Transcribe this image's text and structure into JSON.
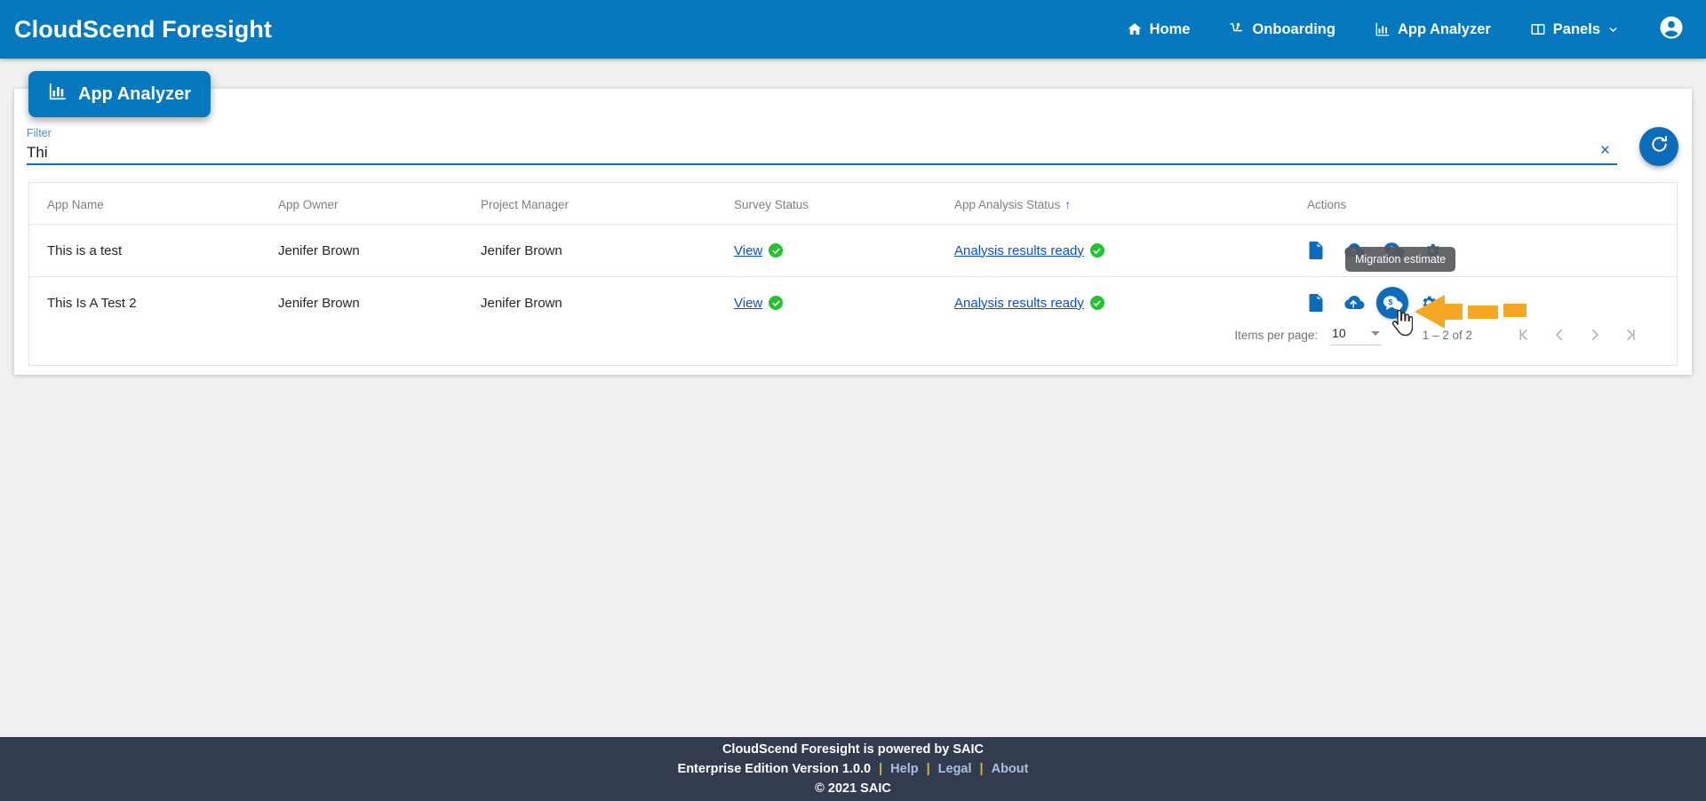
{
  "app": {
    "brand": "CloudScend Foresight"
  },
  "nav": {
    "items": [
      {
        "label": "Home",
        "icon": "home-icon"
      },
      {
        "label": "Onboarding",
        "icon": "onboarding-icon"
      },
      {
        "label": "App Analyzer",
        "icon": "bar-chart-icon"
      },
      {
        "label": "Panels",
        "icon": "panels-icon",
        "caret": "⌄"
      }
    ],
    "account_icon": "account-circle-icon"
  },
  "section": {
    "chip_label": "App Analyzer",
    "chip_icon": "bar-chart-icon"
  },
  "filter": {
    "label": "Filter",
    "value": "Thi",
    "placeholder": "",
    "clear_icon": "×",
    "refresh_icon": "refresh-icon"
  },
  "table": {
    "columns": [
      "App Name",
      "App Owner",
      "Project Manager",
      "Survey Status",
      "App Analysis Status",
      "Actions"
    ],
    "sorted_column": "App Analysis Status",
    "sort_arrow": "↑",
    "rows": [
      {
        "app_name": "This is a test",
        "app_owner": "Jenifer Brown",
        "project_manager": "Jenifer Brown",
        "survey_status": "View",
        "survey_status_ok": true,
        "analysis_status": "Analysis results ready",
        "analysis_status_ok": true,
        "actions": [
          "upload-survey-icon",
          "cloud-upload-icon",
          "migration-estimate-icon",
          "settings-gear-icon"
        ]
      },
      {
        "app_name": "This Is A Test 2",
        "app_owner": "Jenifer Brown",
        "project_manager": "Jenifer Brown",
        "survey_status": "View",
        "survey_status_ok": true,
        "analysis_status": "Analysis results ready",
        "analysis_status_ok": true,
        "actions": [
          "upload-survey-icon",
          "cloud-upload-icon",
          "migration-estimate-icon",
          "settings-gear-icon"
        ]
      }
    ]
  },
  "tooltip": {
    "text": "Migration estimate"
  },
  "paginator": {
    "items_per_page_label": "Items per page:",
    "items_per_page_value": "10",
    "range_label": "1 – 2 of 2",
    "first_icon": "|<",
    "prev_icon": "<",
    "next_icon": ">",
    "last_icon": ">|"
  },
  "footer": {
    "line1": "CloudScend Foresight is powered by SAIC",
    "version": "Enterprise Edition Version 1.0.0",
    "sep": "|",
    "links": [
      "Help",
      "Legal",
      "About"
    ],
    "copyright": "© 2021 SAIC"
  },
  "colors": {
    "header_blue": "#0578be",
    "accent_blue": "#0d6cb9",
    "link_blue": "#0b4fd0",
    "status_green": "#22c32e",
    "footer_navy": "#333b4f",
    "highlight_orange": "#f5a623",
    "page_bg": "#f0f0f0"
  }
}
